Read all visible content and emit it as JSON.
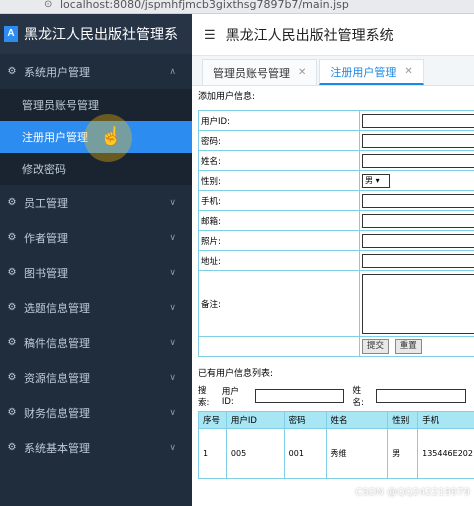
{
  "browser": {
    "url": "localhost:8080/jspmhfjmcb3gixthsg7897b7/main.jsp"
  },
  "sidebar": {
    "brand": "黑龙江人民出版社管理系",
    "logo_letter": "A",
    "groups": [
      {
        "label": "系统用户管理",
        "icon": "gear-icon",
        "expanded": true,
        "items": [
          {
            "label": "管理员账号管理",
            "active": false
          },
          {
            "label": "注册用户管理",
            "active": true
          },
          {
            "label": "修改密码",
            "active": false
          }
        ]
      },
      {
        "label": "员工管理",
        "icon": "gear-icon"
      },
      {
        "label": "作者管理",
        "icon": "gear-icon"
      },
      {
        "label": "图书管理",
        "icon": "gear-icon"
      },
      {
        "label": "选题信息管理",
        "icon": "gear-icon"
      },
      {
        "label": "稿件信息管理",
        "icon": "gear-icon"
      },
      {
        "label": "资源信息管理",
        "icon": "gear-icon"
      },
      {
        "label": "财务信息管理",
        "icon": "gear-icon"
      },
      {
        "label": "系统基本管理",
        "icon": "gear-icon"
      }
    ]
  },
  "header": {
    "title": "黑龙江人民出版社管理系统"
  },
  "tabs": [
    {
      "label": "管理员账号管理",
      "active": false
    },
    {
      "label": "注册用户管理",
      "active": true
    }
  ],
  "form": {
    "section_title": "添加用户信息:",
    "fields": [
      {
        "label": "用户ID:"
      },
      {
        "label": "密码:"
      },
      {
        "label": "姓名:"
      },
      {
        "label": "性别:",
        "select_value": "男 ▾"
      },
      {
        "label": "手机:"
      },
      {
        "label": "邮箱:"
      },
      {
        "label": "照片:"
      },
      {
        "label": "地址:"
      },
      {
        "label": "备注:"
      }
    ],
    "submit_label": "提交",
    "reset_label": "重置"
  },
  "list": {
    "section_title": "已有用户信息列表:",
    "search_label": "搜索:",
    "search_userid_label": "用户ID:",
    "search_name_label": "姓名:",
    "columns": [
      "序号",
      "用户ID",
      "密码",
      "姓名",
      "性别",
      "手机"
    ],
    "rows": [
      [
        "1",
        "005",
        "001",
        "秀维",
        "男",
        "135446E202"
      ]
    ]
  },
  "watermark": "CSDN @QQ242219979"
}
